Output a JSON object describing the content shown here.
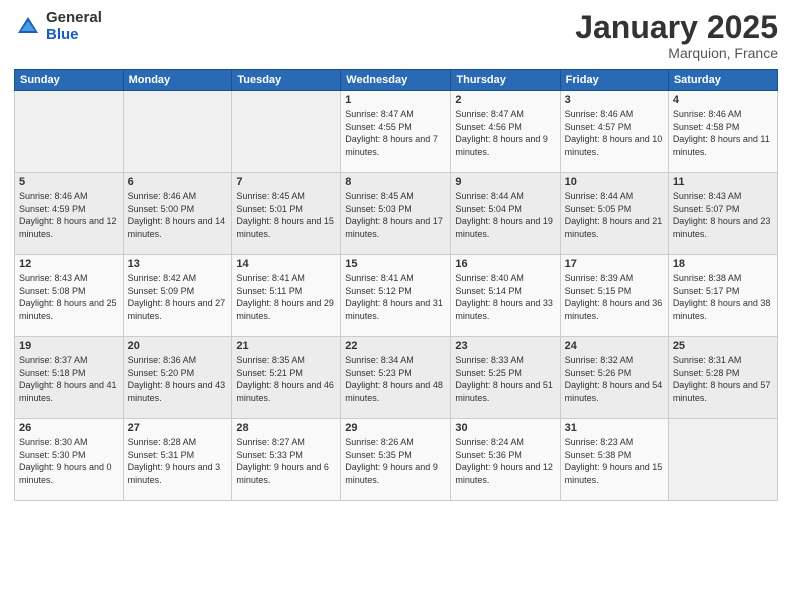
{
  "logo": {
    "general": "General",
    "blue": "Blue"
  },
  "header": {
    "month": "January 2025",
    "location": "Marquion, France"
  },
  "weekdays": [
    "Sunday",
    "Monday",
    "Tuesday",
    "Wednesday",
    "Thursday",
    "Friday",
    "Saturday"
  ],
  "weeks": [
    [
      {
        "day": "",
        "sunrise": "",
        "sunset": "",
        "daylight": ""
      },
      {
        "day": "",
        "sunrise": "",
        "sunset": "",
        "daylight": ""
      },
      {
        "day": "",
        "sunrise": "",
        "sunset": "",
        "daylight": ""
      },
      {
        "day": "1",
        "sunrise": "Sunrise: 8:47 AM",
        "sunset": "Sunset: 4:55 PM",
        "daylight": "Daylight: 8 hours and 7 minutes."
      },
      {
        "day": "2",
        "sunrise": "Sunrise: 8:47 AM",
        "sunset": "Sunset: 4:56 PM",
        "daylight": "Daylight: 8 hours and 9 minutes."
      },
      {
        "day": "3",
        "sunrise": "Sunrise: 8:46 AM",
        "sunset": "Sunset: 4:57 PM",
        "daylight": "Daylight: 8 hours and 10 minutes."
      },
      {
        "day": "4",
        "sunrise": "Sunrise: 8:46 AM",
        "sunset": "Sunset: 4:58 PM",
        "daylight": "Daylight: 8 hours and 11 minutes."
      }
    ],
    [
      {
        "day": "5",
        "sunrise": "Sunrise: 8:46 AM",
        "sunset": "Sunset: 4:59 PM",
        "daylight": "Daylight: 8 hours and 12 minutes."
      },
      {
        "day": "6",
        "sunrise": "Sunrise: 8:46 AM",
        "sunset": "Sunset: 5:00 PM",
        "daylight": "Daylight: 8 hours and 14 minutes."
      },
      {
        "day": "7",
        "sunrise": "Sunrise: 8:45 AM",
        "sunset": "Sunset: 5:01 PM",
        "daylight": "Daylight: 8 hours and 15 minutes."
      },
      {
        "day": "8",
        "sunrise": "Sunrise: 8:45 AM",
        "sunset": "Sunset: 5:03 PM",
        "daylight": "Daylight: 8 hours and 17 minutes."
      },
      {
        "day": "9",
        "sunrise": "Sunrise: 8:44 AM",
        "sunset": "Sunset: 5:04 PM",
        "daylight": "Daylight: 8 hours and 19 minutes."
      },
      {
        "day": "10",
        "sunrise": "Sunrise: 8:44 AM",
        "sunset": "Sunset: 5:05 PM",
        "daylight": "Daylight: 8 hours and 21 minutes."
      },
      {
        "day": "11",
        "sunrise": "Sunrise: 8:43 AM",
        "sunset": "Sunset: 5:07 PM",
        "daylight": "Daylight: 8 hours and 23 minutes."
      }
    ],
    [
      {
        "day": "12",
        "sunrise": "Sunrise: 8:43 AM",
        "sunset": "Sunset: 5:08 PM",
        "daylight": "Daylight: 8 hours and 25 minutes."
      },
      {
        "day": "13",
        "sunrise": "Sunrise: 8:42 AM",
        "sunset": "Sunset: 5:09 PM",
        "daylight": "Daylight: 8 hours and 27 minutes."
      },
      {
        "day": "14",
        "sunrise": "Sunrise: 8:41 AM",
        "sunset": "Sunset: 5:11 PM",
        "daylight": "Daylight: 8 hours and 29 minutes."
      },
      {
        "day": "15",
        "sunrise": "Sunrise: 8:41 AM",
        "sunset": "Sunset: 5:12 PM",
        "daylight": "Daylight: 8 hours and 31 minutes."
      },
      {
        "day": "16",
        "sunrise": "Sunrise: 8:40 AM",
        "sunset": "Sunset: 5:14 PM",
        "daylight": "Daylight: 8 hours and 33 minutes."
      },
      {
        "day": "17",
        "sunrise": "Sunrise: 8:39 AM",
        "sunset": "Sunset: 5:15 PM",
        "daylight": "Daylight: 8 hours and 36 minutes."
      },
      {
        "day": "18",
        "sunrise": "Sunrise: 8:38 AM",
        "sunset": "Sunset: 5:17 PM",
        "daylight": "Daylight: 8 hours and 38 minutes."
      }
    ],
    [
      {
        "day": "19",
        "sunrise": "Sunrise: 8:37 AM",
        "sunset": "Sunset: 5:18 PM",
        "daylight": "Daylight: 8 hours and 41 minutes."
      },
      {
        "day": "20",
        "sunrise": "Sunrise: 8:36 AM",
        "sunset": "Sunset: 5:20 PM",
        "daylight": "Daylight: 8 hours and 43 minutes."
      },
      {
        "day": "21",
        "sunrise": "Sunrise: 8:35 AM",
        "sunset": "Sunset: 5:21 PM",
        "daylight": "Daylight: 8 hours and 46 minutes."
      },
      {
        "day": "22",
        "sunrise": "Sunrise: 8:34 AM",
        "sunset": "Sunset: 5:23 PM",
        "daylight": "Daylight: 8 hours and 48 minutes."
      },
      {
        "day": "23",
        "sunrise": "Sunrise: 8:33 AM",
        "sunset": "Sunset: 5:25 PM",
        "daylight": "Daylight: 8 hours and 51 minutes."
      },
      {
        "day": "24",
        "sunrise": "Sunrise: 8:32 AM",
        "sunset": "Sunset: 5:26 PM",
        "daylight": "Daylight: 8 hours and 54 minutes."
      },
      {
        "day": "25",
        "sunrise": "Sunrise: 8:31 AM",
        "sunset": "Sunset: 5:28 PM",
        "daylight": "Daylight: 8 hours and 57 minutes."
      }
    ],
    [
      {
        "day": "26",
        "sunrise": "Sunrise: 8:30 AM",
        "sunset": "Sunset: 5:30 PM",
        "daylight": "Daylight: 9 hours and 0 minutes."
      },
      {
        "day": "27",
        "sunrise": "Sunrise: 8:28 AM",
        "sunset": "Sunset: 5:31 PM",
        "daylight": "Daylight: 9 hours and 3 minutes."
      },
      {
        "day": "28",
        "sunrise": "Sunrise: 8:27 AM",
        "sunset": "Sunset: 5:33 PM",
        "daylight": "Daylight: 9 hours and 6 minutes."
      },
      {
        "day": "29",
        "sunrise": "Sunrise: 8:26 AM",
        "sunset": "Sunset: 5:35 PM",
        "daylight": "Daylight: 9 hours and 9 minutes."
      },
      {
        "day": "30",
        "sunrise": "Sunrise: 8:24 AM",
        "sunset": "Sunset: 5:36 PM",
        "daylight": "Daylight: 9 hours and 12 minutes."
      },
      {
        "day": "31",
        "sunrise": "Sunrise: 8:23 AM",
        "sunset": "Sunset: 5:38 PM",
        "daylight": "Daylight: 9 hours and 15 minutes."
      },
      {
        "day": "",
        "sunrise": "",
        "sunset": "",
        "daylight": ""
      }
    ]
  ]
}
